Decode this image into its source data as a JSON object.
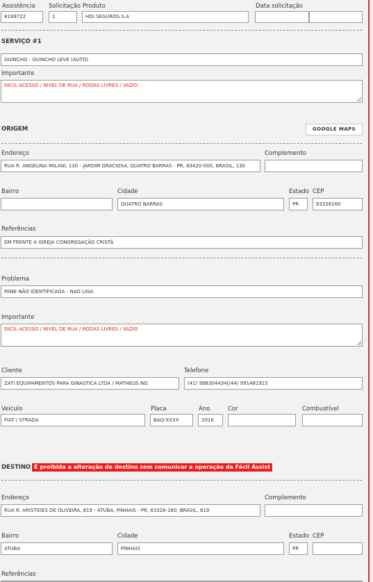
{
  "header": {
    "assistencia_label": "Assistência",
    "assistencia_value": "8199722",
    "solicitacao_label": "Solicitação",
    "solicitacao_value": "1",
    "produto_label": "Produto",
    "produto_value": "HDI SEGUROS S.A",
    "data_label": "Data solicitação",
    "data_value": "",
    "hora_value": ""
  },
  "servico": {
    "title": "SERVIÇO #1",
    "service_value": "GUINCHO - GUINCHO LEVE (AUTO)",
    "importante_label": "Importante",
    "importante_value": "FACIL ACESSO / NIVEL DE RUA / RODAS LIVRES / VAZIO"
  },
  "origem": {
    "title": "ORIGEM",
    "google_maps_label": "GOOGLE MAPS",
    "endereco_label": "Endereço",
    "endereco_value": "RUA R. ANGELINA MILANI, 130 - JARDIM GRACIOSA, QUATRO BARRAS - PR, 83420-000, BRASIL, 130",
    "complemento_label": "Complemento",
    "complemento_value": "",
    "bairro_label": "Bairro",
    "bairro_value": "",
    "cidade_label": "Cidade",
    "cidade_value": "QUATRO BARRAS",
    "estado_label": "Estado",
    "estado_value": "PR",
    "cep_label": "CEP",
    "cep_value": "83326160",
    "referencias_label": "Referências",
    "referencias_value": "EM FRENTE A IGREJA CONGREGAÇÃO CRISTÃ"
  },
  "problema": {
    "problema_label": "Problema",
    "problema_value": "PANE NÃO IDENTIFICADA - NAO LIGA",
    "importante_label": "Importante",
    "importante_value": "FACIL ACESSO / NIVEL DE RUA / RODAS LIVRES / VAZIO",
    "cliente_label": "Cliente",
    "cliente_value": "ZATI EQUIPAMENTOS PARA GINASTICA LTDA / MATHEUS NO",
    "telefone_label": "Telefone",
    "telefone_value": "(41) 998304434|(44) 991481915",
    "veiculo_label": "Veículo",
    "veiculo_value": "FIAT / STRADA",
    "placa_label": "Placa",
    "placa_value": "BAQ-XXXX",
    "ano_label": "Ano",
    "ano_value": "2016",
    "cor_label": "Cor",
    "cor_value": "",
    "combustivel_label": "Combustível",
    "combustivel_value": ""
  },
  "destino": {
    "title": "DESTINO",
    "warning": "É proibida a alteração de destino sem comunicar a operação da Fácil Assist",
    "endereco_label": "Endereço",
    "endereco_value": "RUA R. ARISTÍDES DE OLIVEIRA, 819 - ATUBA, PINHAIS - PR, 83326-160, BRASIL, 819",
    "complemento_label": "Complemento",
    "complemento_value": "",
    "bairro_label": "Bairro",
    "bairro_value": "ATUBA",
    "cidade_label": "Cidade",
    "cidade_value": "PINHAIS",
    "estado_label": "Estado",
    "estado_value": "PR",
    "cep_label": "CEP",
    "cep_value": "",
    "referencias_label": "Referências"
  },
  "colors": {
    "accent_red": "#e32e2e",
    "warning_bg": "#ee1c1c",
    "important_text": "#e02020"
  }
}
